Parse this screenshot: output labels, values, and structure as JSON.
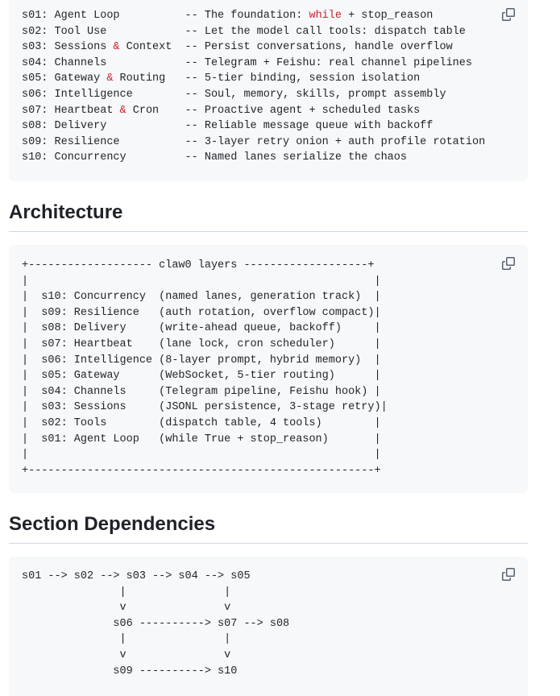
{
  "blocks": {
    "sessions": {
      "lines": [
        "s01: Agent Loop          -- The foundation: while + stop_reason",
        "s02: Tool Use            -- Let the model call tools: dispatch table",
        "s03: Sessions & Context  -- Persist conversations, handle overflow",
        "s04: Channels            -- Telegram + Feishu: real channel pipelines",
        "s05: Gateway & Routing   -- 5-tier binding, session isolation",
        "s06: Intelligence        -- Soul, memory, skills, prompt assembly",
        "s07: Heartbeat & Cron    -- Proactive agent + scheduled tasks",
        "s08: Delivery            -- Reliable message queue with backoff",
        "s09: Resilience          -- 3-layer retry onion + auth profile rotation",
        "s10: Concurrency         -- Named lanes serialize the chaos"
      ]
    },
    "architecture": {
      "heading": "Architecture",
      "lines": [
        "+------------------- claw0 layers -------------------+",
        "|                                                     |",
        "|  s10: Concurrency  (named lanes, generation track)  |",
        "|  s09: Resilience   (auth rotation, overflow compact)|",
        "|  s08: Delivery     (write-ahead queue, backoff)     |",
        "|  s07: Heartbeat    (lane lock, cron scheduler)      |",
        "|  s06: Intelligence (8-layer prompt, hybrid memory)  |",
        "|  s05: Gateway      (WebSocket, 5-tier routing)      |",
        "|  s04: Channels     (Telegram pipeline, Feishu hook) |",
        "|  s03: Sessions     (JSONL persistence, 3-stage retry)|",
        "|  s02: Tools        (dispatch table, 4 tools)        |",
        "|  s01: Agent Loop   (while True + stop_reason)       |",
        "|                                                     |",
        "+-----------------------------------------------------+"
      ]
    },
    "dependencies": {
      "heading": "Section Dependencies",
      "lines": [
        "s01 --> s02 --> s03 --> s04 --> s05",
        "               |               |",
        "               v               v",
        "              s06 ----------> s07 --> s08",
        "               |               |",
        "               v               v",
        "              s09 ----------> s10"
      ]
    }
  },
  "icons": {
    "copy": "copy-icon"
  },
  "colors": {
    "keyword": "#cf222e",
    "code_bg": "#f6f8fa",
    "rule": "#d1d9e0"
  }
}
